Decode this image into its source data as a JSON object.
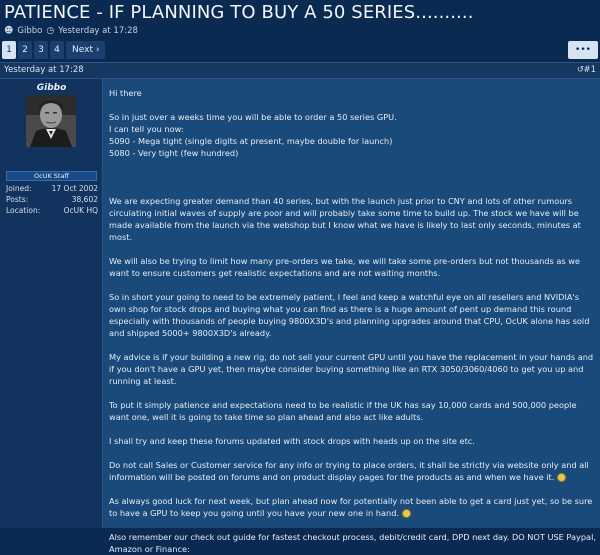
{
  "thread": {
    "title": "PATIENCE - IF PLANNING TO BUY A 50 SERIES..........",
    "author": "Gibbo",
    "date": "Yesterday at 17:28"
  },
  "pagination": {
    "pages": [
      "1",
      "2",
      "3",
      "4"
    ],
    "next_label": "Next ›",
    "actions_label": "•••",
    "current": 1
  },
  "post": {
    "date": "Yesterday at 17:28",
    "number": "#1",
    "share_icon": "share-icon",
    "user": {
      "name": "Gibbo",
      "badge": "OcUK Staff",
      "stats": [
        {
          "label": "Joined:",
          "value": "17 Oct 2002"
        },
        {
          "label": "Posts:",
          "value": "38,602"
        },
        {
          "label": "Location:",
          "value": "OcUK HQ"
        }
      ]
    },
    "paragraphs": [
      "Hi there",
      "So in just over a weeks time you will be able to order a 50 series GPU.",
      "I can tell you now:",
      "5090 - Mega tight (single digits at present, maybe double for launch)",
      "5080 - Very tight (few hundred)",
      "We are expecting greater demand than 40 series, but with the launch just prior to CNY and lots of other rumours circulating initial waves of supply are poor and will probably take some time to build up. The stock we have will be made available from the launch via the webshop but I know what we have is likely to last only seconds, minutes at most.",
      "We will also be trying to limit how many pre-orders we take, we will take some pre-orders but not thousands as we want to ensure customers get realistic expectations and are not waiting months.",
      "So in short your going to need to be extremely patient, I feel and keep a watchful eye on all resellers and NVIDIA's own shop for stock drops and buying what you can find as there is a huge amount of pent up demand this round especially with thousands of people buying 9800X3D's and planning upgrades around that CPU, OcUK alone has sold and shipped 5000+ 9800X3D's already.",
      "My advice is if your building a new rig, do not sell your current GPU until you have the replacement in your hands and if you don't have a GPU yet, then maybe consider buying something like an RTX 3050/3060/4060 to get you up and running at least.",
      "To put it simply patience and expectations need to be realistic if the UK has say 10,000 cards and 500,000 people want one, well it is going to take time so plan ahead and also act like adults.",
      "I shall try and keep these forums updated with stock drops with heads up on the site etc.",
      "Do not call Sales or Customer service for any info or trying to place orders, it shall be strictly via website only and all information will be posted on forums and on product display pages for the products as and when we have it.",
      "As always good luck for next week, but plan ahead now for potentially not been able to get a card just yet, so be sure to have a GPU to keep you going until you have your new one in hand.",
      "Also remember our check out guide for fastest checkout process, debit/credit card, DPD next day. DO NOT USE Paypal, Amazon or Finance:"
    ]
  }
}
